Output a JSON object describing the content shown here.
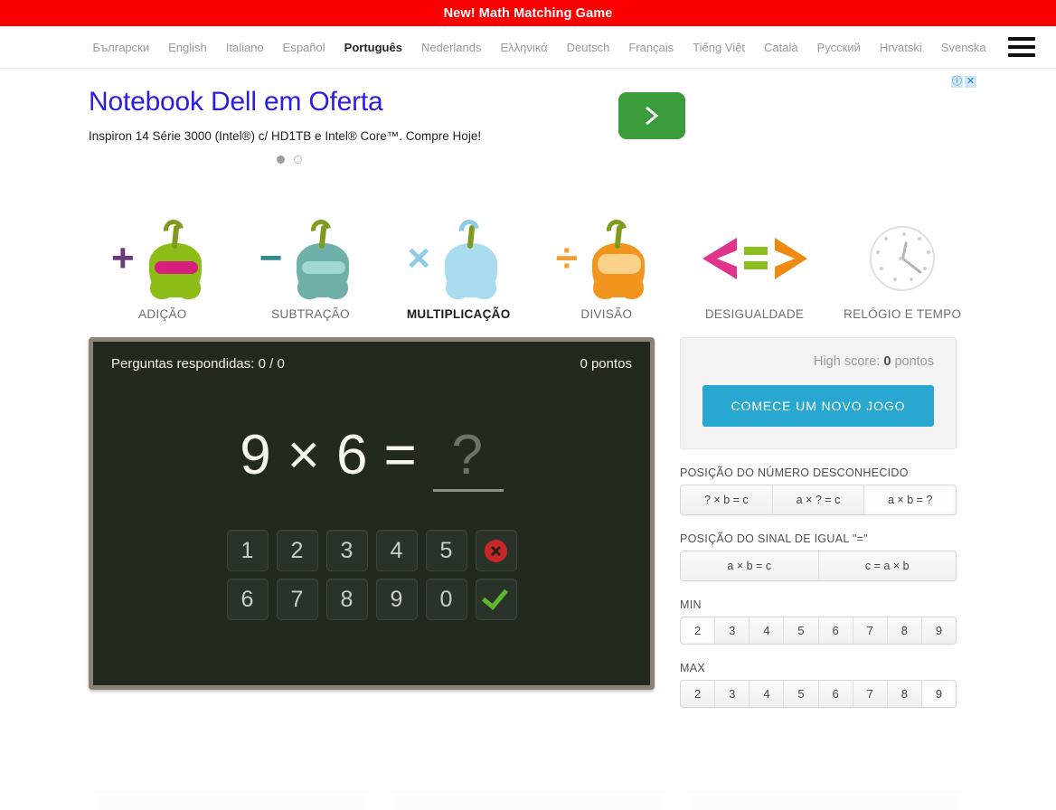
{
  "top_banner": {
    "text": "New! Math Matching Game",
    "bg": "#fb0000",
    "color": "#ffffff"
  },
  "langbar": {
    "items": [
      {
        "label": "Български",
        "active": false
      },
      {
        "label": "English",
        "active": false
      },
      {
        "label": "Italiano",
        "active": false
      },
      {
        "label": "Español",
        "active": false
      },
      {
        "label": "Português",
        "active": true
      },
      {
        "label": "Nederlands",
        "active": false
      },
      {
        "label": "Ελληνικά",
        "active": false
      },
      {
        "label": "Deutsch",
        "active": false
      },
      {
        "label": "Français",
        "active": false
      },
      {
        "label": "Tiếng Việt",
        "active": false
      },
      {
        "label": "Català",
        "active": false
      },
      {
        "label": "Русский",
        "active": false
      },
      {
        "label": "Hrvatski",
        "active": false
      },
      {
        "label": "Svenska",
        "active": false
      }
    ],
    "menu_icon": "hamburger-icon"
  },
  "ad": {
    "title": "Notebook Dell em Oferta",
    "description": "Inspiron 14 Série 3000 (Intel®) c/ HD1TB e Intel® Core™. Compre Hoje!",
    "cta_icon": "chevron-right-icon",
    "cta_color": "#3a9c3a",
    "info_badge": "ⓘ",
    "close_badge": "✕",
    "dots": [
      {
        "active": true
      },
      {
        "active": false
      }
    ]
  },
  "operations": [
    {
      "label": "ADIÇÃO",
      "symbol": "+",
      "symbol_color": "#6b3a7a",
      "icon": "addition-pepper-icon",
      "active": false
    },
    {
      "label": "SUBTRAÇÃO",
      "symbol": "−",
      "symbol_color": "#2f8a8a",
      "icon": "subtraction-pepper-icon",
      "active": false
    },
    {
      "label": "MULTIPLICAÇÃO",
      "symbol": "×",
      "symbol_color": "#8ecbe8",
      "icon": "multiplication-pepper-icon",
      "active": true
    },
    {
      "label": "DIVISÃO",
      "symbol": "÷",
      "symbol_color": "#f0a030",
      "icon": "division-pepper-icon",
      "active": false
    },
    {
      "label": "DESIGUALDADE",
      "symbol": "",
      "icon": "inequality-icon",
      "active": false
    },
    {
      "label": "RELÓGIO E TEMPO",
      "symbol": "",
      "icon": "clock-icon",
      "active": false
    }
  ],
  "board": {
    "answered_label": "Perguntas respondidas: 0 / 0",
    "points_label": "0 pontos",
    "equation": {
      "a": "9",
      "op": "×",
      "b": "6",
      "equals": "=",
      "answer": "?"
    },
    "keypad_row1": [
      "1",
      "2",
      "3",
      "4",
      "5"
    ],
    "keypad_row2": [
      "6",
      "7",
      "8",
      "9",
      "0"
    ],
    "cancel_icon": "cancel-x-icon",
    "confirm_icon": "confirm-check-icon"
  },
  "sidebar": {
    "high_score_prefix": "High score: ",
    "high_score_value": "0",
    "high_score_suffix": " pontos",
    "new_game_label": "COMECE UM NOVO JOGO",
    "new_game_color": "#28a8d0",
    "unknown_position": {
      "caption": "POSIÇÃO DO NÚMERO DESCONHECIDO",
      "options": [
        {
          "label": "? × b = c",
          "selected": false
        },
        {
          "label": "a × ? = c",
          "selected": false
        },
        {
          "label": "a × b = ?",
          "selected": true
        }
      ]
    },
    "equals_position": {
      "caption": "POSIÇÃO DO SINAL DE IGUAL \"=\"",
      "options": [
        {
          "label": "a × b = c",
          "selected": false
        },
        {
          "label": "c = a × b",
          "selected": false
        }
      ]
    },
    "min": {
      "caption": "MIN",
      "options": [
        {
          "label": "2",
          "selected": true
        },
        {
          "label": "3",
          "selected": false
        },
        {
          "label": "4",
          "selected": false
        },
        {
          "label": "5",
          "selected": false
        },
        {
          "label": "6",
          "selected": false
        },
        {
          "label": "7",
          "selected": false
        },
        {
          "label": "8",
          "selected": false
        },
        {
          "label": "9",
          "selected": false
        }
      ]
    },
    "max": {
      "caption": "MAX",
      "options": [
        {
          "label": "2",
          "selected": false
        },
        {
          "label": "3",
          "selected": false
        },
        {
          "label": "4",
          "selected": false
        },
        {
          "label": "5",
          "selected": false
        },
        {
          "label": "6",
          "selected": false
        },
        {
          "label": "7",
          "selected": false
        },
        {
          "label": "8",
          "selected": false
        },
        {
          "label": "9",
          "selected": true
        }
      ]
    }
  }
}
